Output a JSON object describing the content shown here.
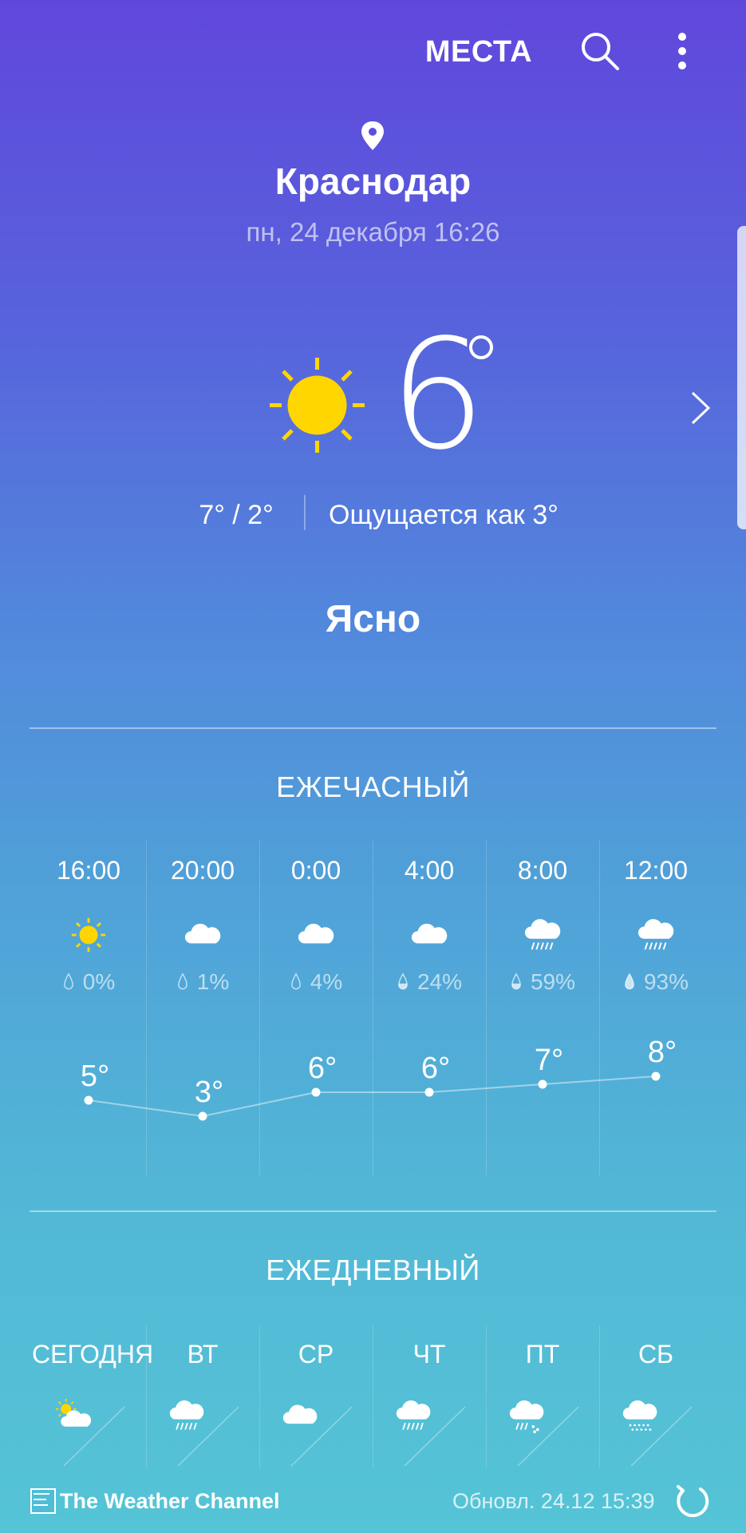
{
  "header": {
    "places_label": "МЕСТА",
    "search_icon": "search-icon",
    "more_icon": "more-vert-icon"
  },
  "location": {
    "city": "Краснодар",
    "datetime": "пн, 24 декабря 16:26"
  },
  "current": {
    "temperature": "6",
    "high_low": "7° / 2°",
    "feels_like": "Ощущается как 3°",
    "condition": "Ясно",
    "icon": "sun-icon"
  },
  "hourly": {
    "title": "ЕЖЕЧАСНЫЙ",
    "items": [
      {
        "time": "16:00",
        "icon": "sun-icon",
        "precip": "0%",
        "temp": "5°",
        "temp_value": 5
      },
      {
        "time": "20:00",
        "icon": "cloud-icon",
        "precip": "1%",
        "temp": "3°",
        "temp_value": 3
      },
      {
        "time": "0:00",
        "icon": "cloud-icon",
        "precip": "4%",
        "temp": "6°",
        "temp_value": 6
      },
      {
        "time": "4:00",
        "icon": "cloud-icon",
        "precip": "24%",
        "temp": "6°",
        "temp_value": 6
      },
      {
        "time": "8:00",
        "icon": "rain-cloud-icon",
        "precip": "59%",
        "temp": "7°",
        "temp_value": 7
      },
      {
        "time": "12:00",
        "icon": "rain-cloud-icon",
        "precip": "93%",
        "temp": "8°",
        "temp_value": 8
      }
    ]
  },
  "daily": {
    "title": "ЕЖЕДНЕВНЫЙ",
    "items": [
      {
        "label": "СЕГОДНЯ",
        "icon": "partly-sunny-icon"
      },
      {
        "label": "ВТ",
        "icon": "rain-cloud-icon"
      },
      {
        "label": "СР",
        "icon": "cloud-icon"
      },
      {
        "label": "ЧТ",
        "icon": "rain-cloud-icon"
      },
      {
        "label": "ПТ",
        "icon": "sleet-cloud-icon"
      },
      {
        "label": "СБ",
        "icon": "snow-cloud-icon"
      }
    ]
  },
  "footer": {
    "brand": "The Weather Channel",
    "updated": "Обновл.  24.12  15:39",
    "refresh_icon": "refresh-icon"
  },
  "colors": {
    "sun": "#FFD600",
    "gradient_top": "#6047dc",
    "gradient_bottom": "#55c4d6"
  }
}
